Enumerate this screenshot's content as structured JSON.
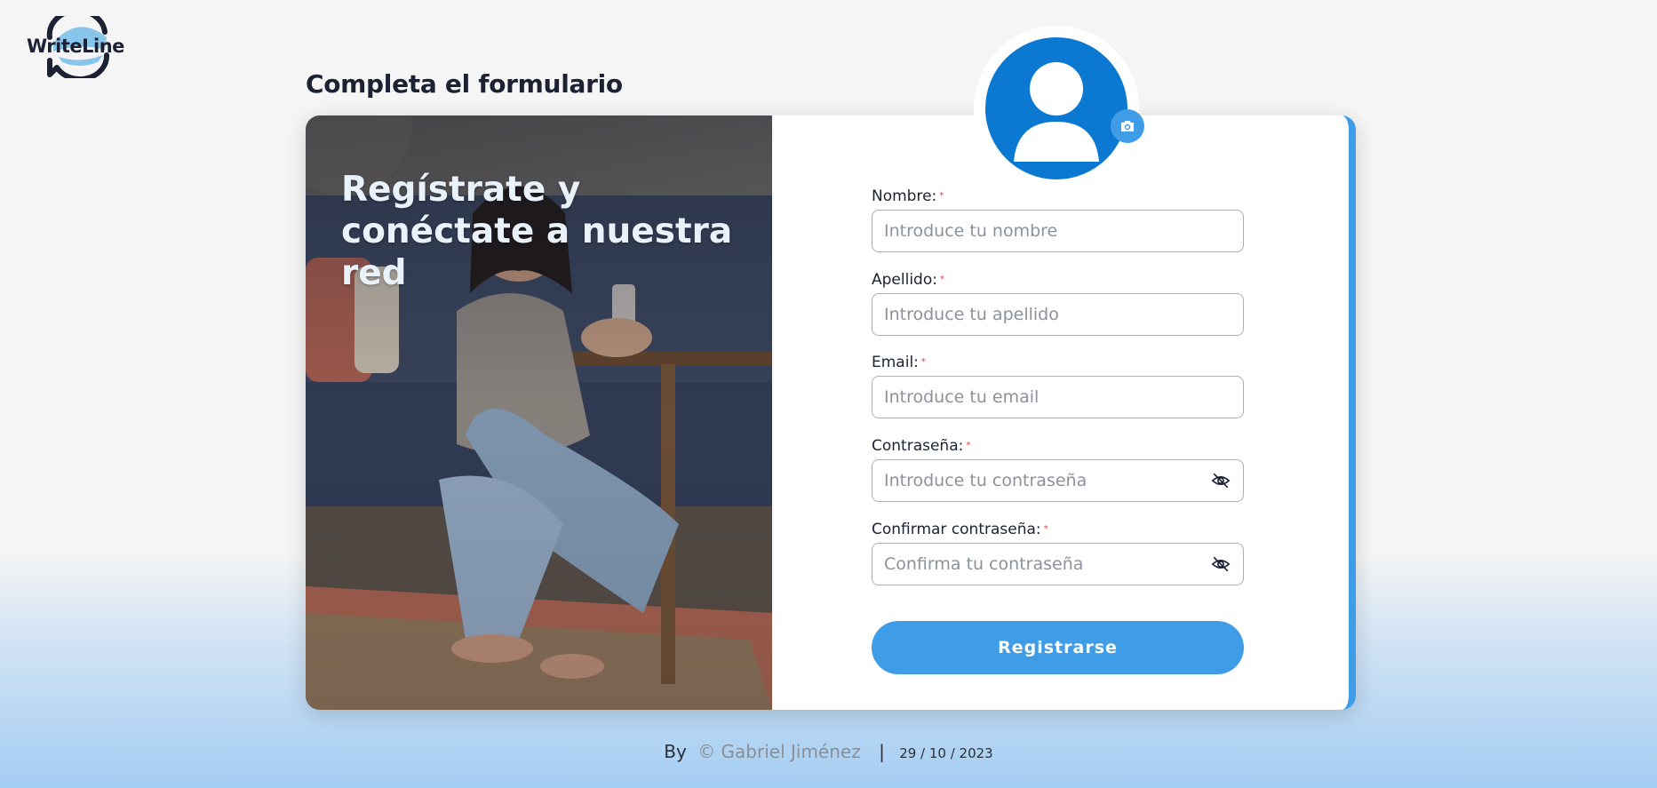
{
  "brand": {
    "logo_text": "WriteLine"
  },
  "page": {
    "title": "Completa el formulario"
  },
  "hero": {
    "heading": "Regístrate y conéctate a nuestra red"
  },
  "avatar": {
    "icon": "user-icon",
    "upload_icon": "camera-icon"
  },
  "form": {
    "fields": [
      {
        "label": "Nombre:",
        "placeholder": "Introduce tu nombre",
        "required_mark": "*",
        "type": "text"
      },
      {
        "label": "Apellido:",
        "placeholder": "Introduce tu apellido",
        "required_mark": "*",
        "type": "text"
      },
      {
        "label": "Email:",
        "placeholder": "Introduce tu email",
        "required_mark": "*",
        "type": "email"
      },
      {
        "label": "Contraseña:",
        "placeholder": "Introduce tu contraseña",
        "required_mark": "*",
        "type": "password",
        "icon": "eye-slash-icon"
      },
      {
        "label": "Confirmar contraseña:",
        "placeholder": "Confirma tu contraseña",
        "required_mark": "*",
        "type": "password",
        "icon": "eye-slash-icon"
      }
    ],
    "submit_label": "Registrarse"
  },
  "footer": {
    "by": "By",
    "author": "© Gabriel Jiménez",
    "separator": "|",
    "date": "29 / 10 / 2023"
  },
  "colors": {
    "accent": "#3f9de8",
    "avatar": "#0b78d2",
    "text": "#1c2233",
    "required": "#e53935"
  }
}
